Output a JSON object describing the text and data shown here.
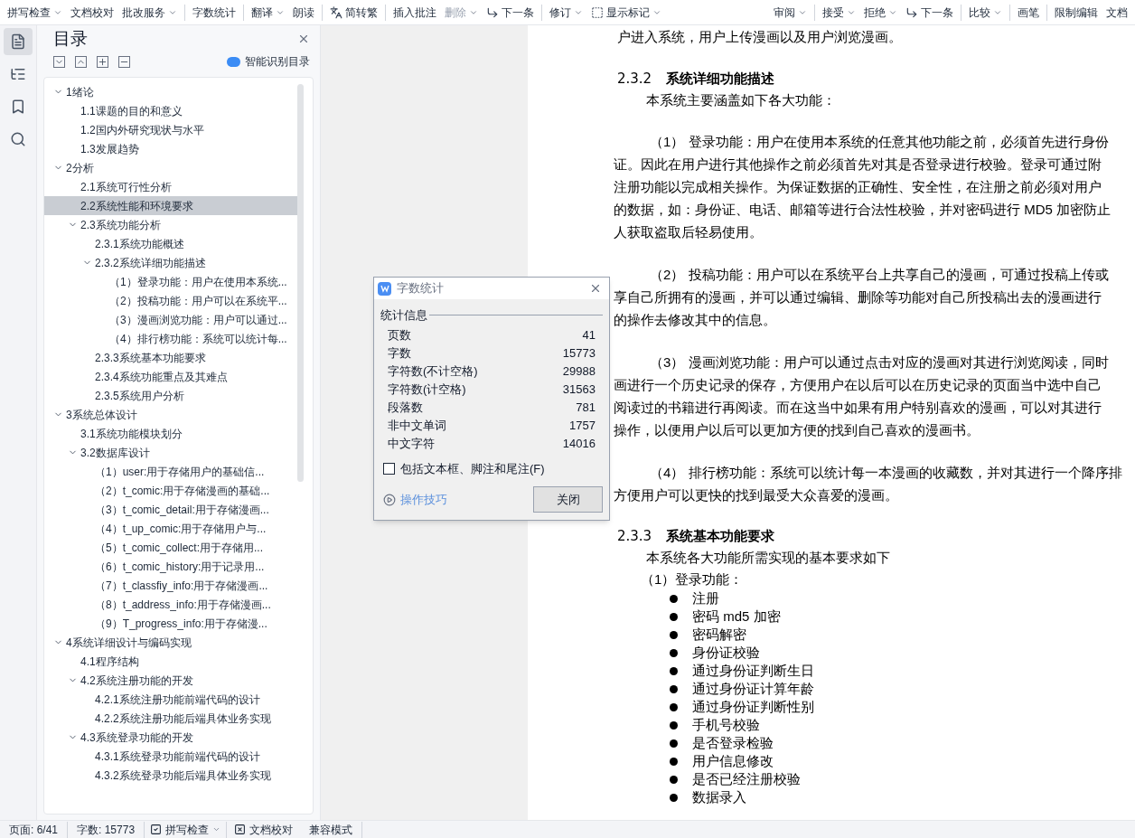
{
  "toolbar": {
    "left_groups": [
      {
        "items": [
          {
            "label": "拼写检查",
            "kind": "plain",
            "dropdown": true,
            "disabled": false
          },
          {
            "label": "文档校对",
            "kind": "plain",
            "dropdown": false,
            "disabled": false
          },
          {
            "label": "批改服务",
            "kind": "plain",
            "dropdown": true,
            "disabled": false
          }
        ]
      },
      {
        "items": [
          {
            "label": "字数统计",
            "kind": "plain",
            "dropdown": false,
            "disabled": false
          }
        ]
      },
      {
        "items": [
          {
            "label": "翻译",
            "kind": "plain",
            "dropdown": true,
            "disabled": false
          },
          {
            "label": "朗读",
            "kind": "plain",
            "dropdown": false,
            "disabled": false
          }
        ]
      },
      {
        "items": [
          {
            "label": "简转繁",
            "kind": "convert",
            "dropdown": false,
            "disabled": false
          }
        ]
      },
      {
        "items": [
          {
            "label": "插入批注",
            "kind": "plain",
            "dropdown": false,
            "disabled": false
          },
          {
            "label": "删除",
            "kind": "plain",
            "dropdown": true,
            "disabled": true
          },
          {
            "label": "下一条",
            "kind": "next",
            "dropdown": false,
            "disabled": false
          }
        ]
      },
      {
        "items": [
          {
            "label": "修订",
            "kind": "plain",
            "dropdown": true,
            "disabled": false
          },
          {
            "label": "显示标记",
            "kind": "markup",
            "dropdown": true,
            "disabled": false
          }
        ]
      }
    ],
    "right_groups": [
      {
        "items": [
          {
            "label": "审阅",
            "kind": "plain",
            "dropdown": true,
            "disabled": false
          }
        ]
      },
      {
        "items": [
          {
            "label": "接受",
            "kind": "plain",
            "dropdown": true,
            "disabled": false
          },
          {
            "label": "拒绝",
            "kind": "plain",
            "dropdown": true,
            "disabled": false
          },
          {
            "label": "下一条",
            "kind": "next",
            "dropdown": false,
            "disabled": false
          }
        ]
      },
      {
        "items": [
          {
            "label": "比较",
            "kind": "plain",
            "dropdown": true,
            "disabled": false
          }
        ]
      },
      {
        "items": [
          {
            "label": "画笔",
            "kind": "plain",
            "dropdown": false,
            "disabled": false
          }
        ]
      },
      {
        "items": [
          {
            "label": "限制编辑",
            "kind": "plain",
            "dropdown": false,
            "disabled": false
          },
          {
            "label": "文档",
            "kind": "plain",
            "dropdown": false,
            "disabled": false
          }
        ]
      }
    ]
  },
  "rail": [
    {
      "kind": "outline",
      "selected": true
    },
    {
      "kind": "tree",
      "selected": false
    },
    {
      "kind": "bookmark",
      "selected": false
    },
    {
      "kind": "search",
      "selected": false
    }
  ],
  "toc": {
    "title": "目录",
    "smart_button": "智能识别目录",
    "items": [
      {
        "label": "1绪论",
        "selected": false,
        "expanded": true,
        "children": [
          {
            "label": "1.1课题的目的和意义",
            "selected": false
          },
          {
            "label": "1.2国内外研究现状与水平",
            "selected": false
          },
          {
            "label": "1.3发展趋势",
            "selected": false
          }
        ]
      },
      {
        "label": "2分析",
        "selected": false,
        "expanded": true,
        "children": [
          {
            "label": "2.1系统可行性分析",
            "selected": false
          },
          {
            "label": "2.2系统性能和环境要求",
            "selected": true
          },
          {
            "label": "2.3系统功能分析",
            "selected": false,
            "expanded": true,
            "children": [
              {
                "label": "2.3.1系统功能概述",
                "selected": false
              },
              {
                "label": "2.3.2系统详细功能描述",
                "selected": false,
                "expanded": true,
                "children": [
                  {
                    "label": "（1）登录功能：用户在使用本系统...",
                    "selected": false
                  },
                  {
                    "label": "（2）投稿功能：用户可以在系统平...",
                    "selected": false
                  },
                  {
                    "label": "（3）漫画浏览功能：用户可以通过...",
                    "selected": false
                  },
                  {
                    "label": "（4）排行榜功能：系统可以统计每...",
                    "selected": false
                  }
                ]
              },
              {
                "label": "2.3.3系统基本功能要求",
                "selected": false
              },
              {
                "label": "2.3.4系统功能重点及其难点",
                "selected": false
              },
              {
                "label": "2.3.5系统用户分析",
                "selected": false
              }
            ]
          }
        ]
      },
      {
        "label": "3系统总体设计",
        "selected": false,
        "expanded": true,
        "children": [
          {
            "label": "3.1系统功能模块划分",
            "selected": false
          },
          {
            "label": "3.2数据库设计",
            "selected": false,
            "expanded": true,
            "children": [
              {
                "label": "（1）user:用于存储用户的基础信...",
                "selected": false
              },
              {
                "label": "（2）t_comic:用于存储漫画的基础...",
                "selected": false
              },
              {
                "label": "（3）t_comic_detail:用于存储漫画...",
                "selected": false
              },
              {
                "label": "（4）t_up_comic:用于存储用户与...",
                "selected": false
              },
              {
                "label": "（5）t_comic_collect:用于存储用...",
                "selected": false
              },
              {
                "label": "（6）t_comic_history:用于记录用...",
                "selected": false
              },
              {
                "label": "（7）t_classfiy_info:用于存储漫画...",
                "selected": false
              },
              {
                "label": "（8）t_address_info:用于存储漫画...",
                "selected": false
              },
              {
                "label": "（9）T_progress_info:用于存储漫...",
                "selected": false
              }
            ]
          }
        ]
      },
      {
        "label": "4系统详细设计与编码实现",
        "selected": false,
        "expanded": true,
        "children": [
          {
            "label": "4.1程序结构",
            "selected": false
          },
          {
            "label": "4.2系统注册功能的开发",
            "selected": false,
            "expanded": true,
            "children": [
              {
                "label": "4.2.1系统注册功能前端代码的设计",
                "selected": false
              },
              {
                "label": "4.2.2系统注册功能后端具体业务实现",
                "selected": false
              }
            ]
          },
          {
            "label": "4.3系统登录功能的开发",
            "selected": false,
            "expanded": true,
            "children": [
              {
                "label": "4.3.1系统登录功能前端代码的设计",
                "selected": false
              },
              {
                "label": "4.3.2系统登录功能后端具体业务实现",
                "selected": false
              }
            ]
          }
        ]
      }
    ]
  },
  "document": {
    "top_lines": [
      "户进入系统，用户上传漫画以及用户浏览漫画。"
    ],
    "sections": [
      {
        "number": "2.3.2",
        "title": "系统详细功能描述",
        "intro": "本系统主要涵盖如下各大功能：",
        "paragraphs": [
          {
            "lines": [
              "（1） 登录功能：用户在使用本系统的任意其他功能之前，必须首先进行身份",
              "证。因此在用户进行其他操作之前必须首先对其是否登录进行校验。登录可通过附",
              "注册功能以完成相关操作。为保证数据的正确性、安全性，在注册之前必须对用户",
              "的数据，如：身份证、电话、邮箱等进行合法性校验，并对密码进行 MD5 加密防止",
              "人获取盗取后轻易使用。"
            ]
          },
          {
            "lines": [
              "（2） 投稿功能：用户可以在系统平台上共享自己的漫画，可通过投稿上传或",
              "享自己所拥有的漫画，并可以通过编辑、删除等功能对自己所投稿出去的漫画进行",
              "的操作去修改其中的信息。"
            ]
          },
          {
            "lines": [
              "（3） 漫画浏览功能：用户可以通过点击对应的漫画对其进行浏览阅读，同时",
              "画进行一个历史记录的保存，方便用户在以后可以在历史记录的页面当中选中自己",
              "阅读过的书籍进行再阅读。而在这当中如果有用户特别喜欢的漫画，可以对其进行",
              "操作，以便用户以后可以更加方便的找到自己喜欢的漫画书。"
            ]
          },
          {
            "lines": [
              "（4） 排行榜功能：系统可以统计每一本漫画的收藏数，并对其进行一个降序排",
              "方便用户可以更快的找到最受大众喜爱的漫画。"
            ]
          }
        ]
      },
      {
        "number": "2.3.3",
        "title": "系统基本功能要求",
        "intro": "本系统各大功能所需实现的基本要求如下",
        "subheading": "（1）登录功能：",
        "bullets": [
          "注册",
          "密码 md5 加密",
          "密码解密",
          "身份证校验",
          "通过身份证判断生日",
          "通过身份证计算年龄",
          "通过身份证判断性别",
          "手机号校验",
          "是否登录检验",
          "用户信息修改",
          "是否已经注册校验",
          "数据录入"
        ]
      }
    ]
  },
  "dialog": {
    "title": "字数统计",
    "group": "统计信息",
    "stats": [
      {
        "label": "页数",
        "value": "41"
      },
      {
        "label": "字数",
        "value": "15773"
      },
      {
        "label": "字符数(不计空格)",
        "value": "29988"
      },
      {
        "label": "字符数(计空格)",
        "value": "31563"
      },
      {
        "label": "段落数",
        "value": "781"
      },
      {
        "label": "非中文单词",
        "value": "1757"
      },
      {
        "label": "中文字符",
        "value": "14016"
      }
    ],
    "checkbox": {
      "label": "包括文本框、脚注和尾注(F)",
      "checked": false
    },
    "tips_link": "操作技巧",
    "close_button": "关闭"
  },
  "status_bar": {
    "page": "页面: 6/41",
    "words": "字数: 15773",
    "spell_check": "拼写检查",
    "proofread": "文档校对",
    "mode": "兼容模式"
  }
}
